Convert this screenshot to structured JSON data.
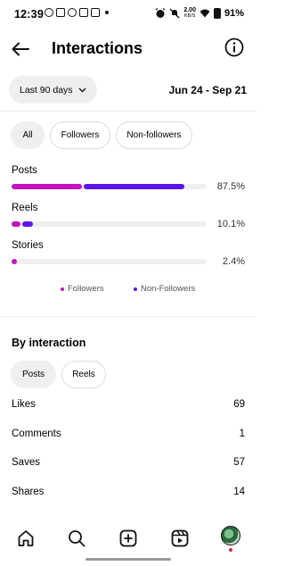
{
  "status_bar": {
    "time": "12:39",
    "speed_value": "2.00",
    "speed_unit": "KB/S",
    "battery": "91%"
  },
  "header": {
    "title": "Interactions",
    "back_icon": "arrow-left-icon",
    "info_icon": "info-icon"
  },
  "date_filter": {
    "selected": "Last 90 days",
    "range": "Jun 24 - Sep 21"
  },
  "audience_tabs": [
    {
      "label": "All",
      "active": true
    },
    {
      "label": "Followers",
      "active": false
    },
    {
      "label": "Non-followers",
      "active": false
    }
  ],
  "chart_data": {
    "type": "bar",
    "categories": [
      "Posts",
      "Reels",
      "Stories"
    ],
    "totals_percent": [
      "87.5%",
      "10.1%",
      "2.4%"
    ],
    "series": [
      {
        "name": "Followers",
        "values": [
          35.9,
          4.6,
          2.4
        ]
      },
      {
        "name": "Non-Followers",
        "values": [
          51.6,
          5.5,
          0
        ]
      }
    ],
    "colors": {
      "Followers": "#c513c2",
      "Non-Followers": "#5b15e8",
      "track": "#efeff2"
    },
    "ylim": [
      0,
      100
    ]
  },
  "legend": {
    "followers": "Followers",
    "non_followers": "Non-Followers"
  },
  "by_interaction": {
    "title": "By interaction",
    "tabs": [
      {
        "label": "Posts",
        "active": true
      },
      {
        "label": "Reels",
        "active": false
      }
    ],
    "stats": [
      {
        "label": "Likes",
        "value": "69"
      },
      {
        "label": "Comments",
        "value": "1"
      },
      {
        "label": "Saves",
        "value": "57"
      },
      {
        "label": "Shares",
        "value": "14"
      }
    ]
  },
  "bottom_nav": {
    "items": [
      "home-icon",
      "search-icon",
      "create-icon",
      "reels-icon",
      "profile-avatar"
    ]
  }
}
